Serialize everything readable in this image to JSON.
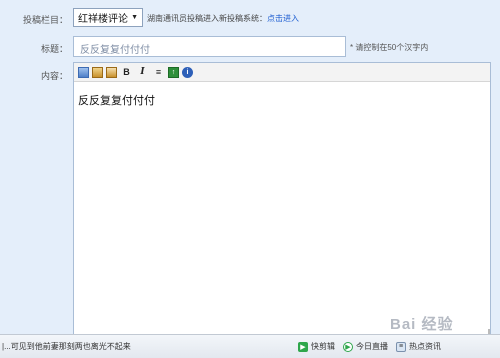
{
  "form": {
    "column_label": "投稿栏目：",
    "column_select_value": "红祥楼评论",
    "column_note": "湖南通讯员投稿进入新投稿系统：",
    "column_note_link": "点击进入",
    "title_label": "标题：",
    "title_value": "反反复复付付付",
    "title_hint": "* 请控制在50个汉字内",
    "content_label": "内容：",
    "content_text": "反反复复付付付"
  },
  "toolbar": {
    "buttons": [
      {
        "name": "copy-icon",
        "glyph": ""
      },
      {
        "name": "paste-icon",
        "glyph": ""
      },
      {
        "name": "paste-word-icon",
        "glyph": ""
      },
      {
        "name": "bold-button",
        "glyph": "B"
      },
      {
        "name": "italic-button",
        "glyph": "I"
      },
      {
        "name": "align-icon",
        "glyph": "≡"
      },
      {
        "name": "insert-image-icon",
        "glyph": "↑"
      },
      {
        "name": "about-icon",
        "glyph": "i"
      }
    ]
  },
  "taskbar": {
    "ticker": "|...可见到他前妻那刻两也离光不起来",
    "items": [
      {
        "label": "快剪辑",
        "icon": "play-icon"
      },
      {
        "label": "今日直播",
        "icon": "live-icon"
      },
      {
        "label": "热点资讯",
        "icon": "news-icon"
      }
    ]
  },
  "watermark": "Bai 经验"
}
